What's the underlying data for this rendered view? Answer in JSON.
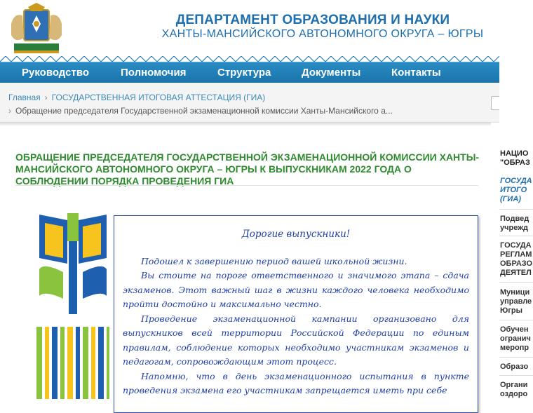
{
  "header": {
    "dept_line1": "ДЕПАРТАМЕНТ ОБРАЗОВАНИЯ И НАУКИ",
    "dept_line2": "ХАНТЫ-МАНСИЙСКОГО АВТОНОМНОГО ОКРУГА – ЮГРЫ",
    "brand_color": "#1e6fae"
  },
  "nav": {
    "items": [
      {
        "label": "Руководство"
      },
      {
        "label": "Полномочия"
      },
      {
        "label": "Структура"
      },
      {
        "label": "Документы"
      },
      {
        "label": "Контакты"
      }
    ]
  },
  "breadcrumb": {
    "home": "Главная",
    "separator": "›",
    "section": "ГОСУДАРСТВЕННАЯ ИТОГОВАЯ АТТЕСТАЦИЯ (ГИА)",
    "current": "Обращение председателя Государственной экзаменационной комиссии Ханты-Мансийского а..."
  },
  "article": {
    "title": "ОБРАЩЕНИЕ ПРЕДСЕДАТЕЛЯ ГОСУДАРСТВЕННОЙ ЭКЗАМЕНАЦИОННОЙ КОМИССИИ ХАНТЫ-МАНСИЙСКОГО АВТОНОМНОГО ОКРУГА – ЮГРЫ К ВЫПУСКНИКАМ 2022 ГОДА О СОБЛЮДЕНИИ ПОРЯДКА ПРОВЕДЕНИЯ ГИА",
    "title_color": "#2f8b2f",
    "letter": {
      "salutation": "Дорогие выпускники!",
      "paragraphs": [
        "Подошел к завершению период вашей школьной жизни.",
        "Вы стоите на пороге ответственного и значимого этапа – сдача экзаменов. Этот важный шаг в жизни каждого человека необходимо пройти достойно и максимально честно.",
        "Проведение экзаменационной кампании организовано для выпускников всей территории Российской Федерации по единым правилам, соблюдение которых необходимо участникам экзаменов и педагогам, сопровождающим этот процесс.",
        "Напомню, что в день экзаменационного испытания в пункте проведения экзамена его участникам запрещается иметь при себе"
      ]
    }
  },
  "sidebar": {
    "items": [
      {
        "label": "НАЦИО\n\"ОБРАЗ",
        "style": "head"
      },
      {
        "label": "ГОСУДА\nИТОГО\n(ГИА)",
        "style": "link"
      },
      {
        "label": "Подвед\nучрежд",
        "style": "normal"
      },
      {
        "label": "ГОСУДА\nРЕГЛАМ\nОБРАЗО\nДЕЯТЕЛ",
        "style": "normal"
      },
      {
        "label": "Муници\nуправле\nЮгры",
        "style": "normal"
      },
      {
        "label": "Обучен\nогранич\nмеропр",
        "style": "normal"
      },
      {
        "label": "Образо",
        "style": "normal"
      },
      {
        "label": "Органи\nоздоро",
        "style": "normal"
      }
    ]
  }
}
